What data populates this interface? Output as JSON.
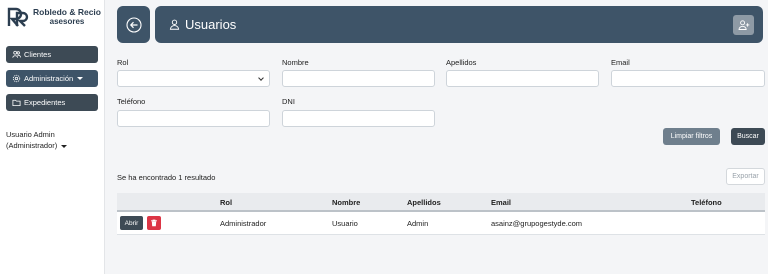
{
  "brand": {
    "name": "Robledo & Recio",
    "subtitle": "asesores"
  },
  "sidebar": {
    "items": [
      {
        "label": "Clientes",
        "icon": "users-icon"
      },
      {
        "label": "Administración",
        "icon": "gear-icon"
      },
      {
        "label": "Expedientes",
        "icon": "folder-icon"
      }
    ],
    "user": {
      "name": "Usuario Admin",
      "role": "(Administrador)"
    }
  },
  "header": {
    "title": "Usuarios"
  },
  "filters": {
    "rol": {
      "label": "Rol",
      "value": ""
    },
    "nombre": {
      "label": "Nombre",
      "value": ""
    },
    "apellidos": {
      "label": "Apellidos",
      "value": ""
    },
    "email": {
      "label": "Email",
      "value": ""
    },
    "telefono": {
      "label": "Teléfono",
      "value": ""
    },
    "dni": {
      "label": "DNI",
      "value": ""
    },
    "clear_label": "Limpiar filtros",
    "search_label": "Buscar"
  },
  "results": {
    "summary": "Se ha encontrado 1 resultado",
    "export_label": "Exportar"
  },
  "table": {
    "columns": [
      "Rol",
      "Nombre",
      "Apellidos",
      "Email",
      "Teléfono"
    ],
    "open_label": "Abrir",
    "rows": [
      {
        "rol": "Administrador",
        "nombre": "Usuario",
        "apellidos": "Admin",
        "email": "asainz@grupogestyde.com",
        "telefono": ""
      }
    ]
  },
  "colors": {
    "primary": "#3e5468",
    "dark": "#3d4a55",
    "danger": "#dc3545",
    "muted": "#6f7f8d"
  }
}
